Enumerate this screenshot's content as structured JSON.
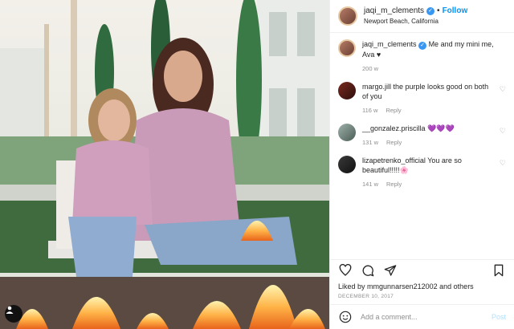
{
  "header": {
    "username": "jaqi_m_clements",
    "verified_mark": "✓",
    "separator": "•",
    "follow_label": "Follow",
    "location": "Newport Beach, California"
  },
  "caption": {
    "username": "jaqi_m_clements",
    "verified_mark": "✓",
    "text": "Me and my mini me, Ava ♥",
    "likes": "200 w"
  },
  "comments": [
    {
      "user": "margo.jill",
      "text": "the purple looks good on both of you",
      "time": "116 w",
      "reply": "Reply"
    },
    {
      "user": "__gonzalez.priscilla",
      "text": "💜💜💜",
      "time": "131 w",
      "reply": "Reply"
    },
    {
      "user": "lizapetrenko_official",
      "text": "You are so beautiful!!!!!🌸",
      "time": "141 w",
      "reply": "Reply"
    }
  ],
  "footer": {
    "liked_by": "Liked by",
    "liked_user": "mmgunnarsen212002",
    "and": "and",
    "others": "others",
    "date": "DECEMBER 10, 2017",
    "add_comment_placeholder": "Add a comment...",
    "post_label": "Post"
  },
  "icons": {
    "heart": "heart-icon",
    "comment": "comment-icon",
    "share": "share-icon",
    "save": "bookmark-icon",
    "emoji": "emoji-icon",
    "more": "more-icon"
  },
  "colors": {
    "accent": "#0095f6",
    "verified": "#3897f0",
    "muted": "#8e8e8e"
  }
}
